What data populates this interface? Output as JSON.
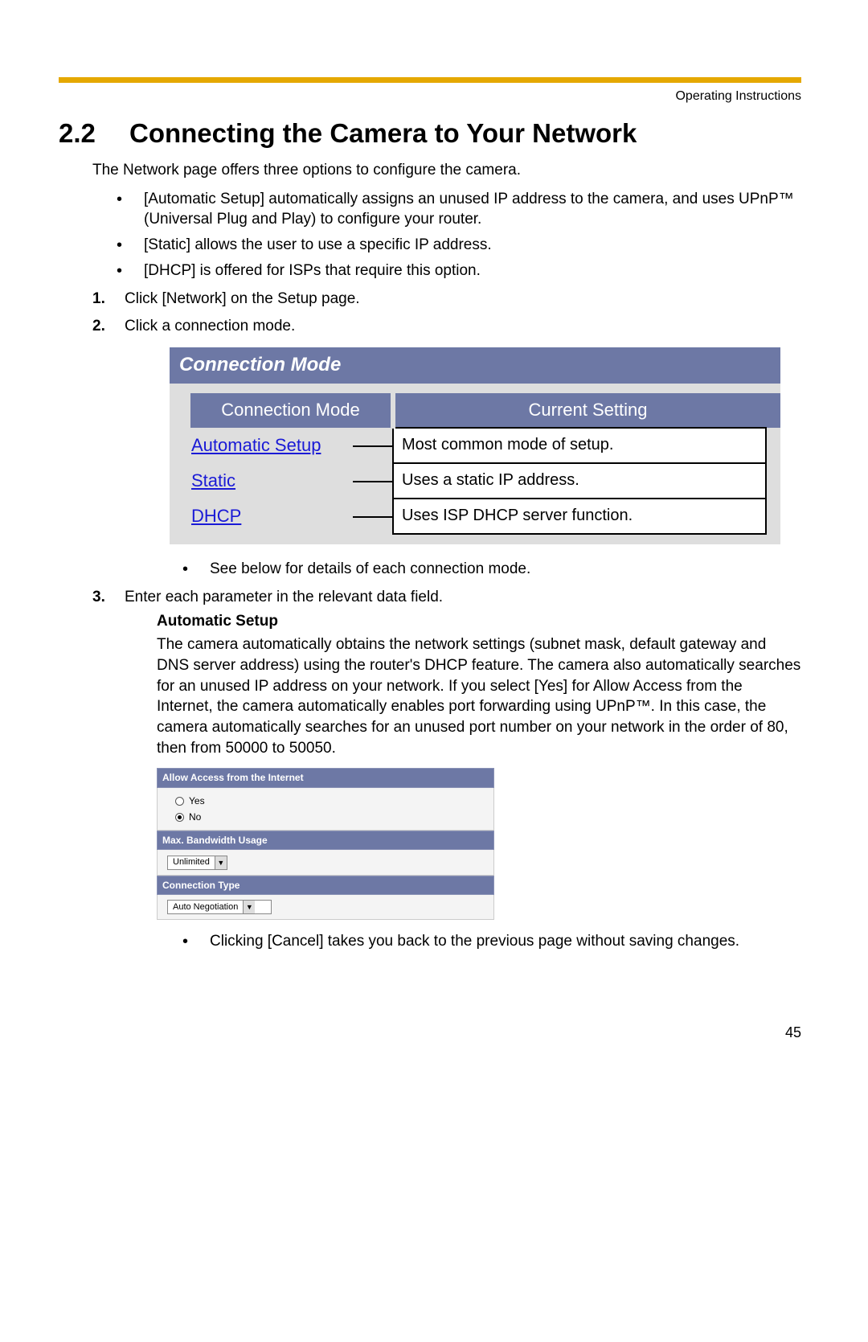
{
  "header": {
    "label": "Operating Instructions"
  },
  "section": {
    "number": "2.2",
    "title": "Connecting the Camera to Your Network"
  },
  "intro": "The Network page offers three options to configure the camera.",
  "options": [
    "[Automatic Setup] automatically assigns an unused IP address to the camera, and uses UPnP™ (Universal Plug and Play) to configure your router.",
    "[Static] allows the user to use a specific IP address.",
    "[DHCP] is offered for ISPs that require this option."
  ],
  "step1": "Click [Network] on the Setup page.",
  "step2": "Click a connection mode.",
  "connFigure": {
    "title": "Connection Mode",
    "col1": "Connection Mode",
    "col2": "Current Setting",
    "rows": [
      {
        "link": "Automatic Setup",
        "desc": "Most common mode of setup."
      },
      {
        "link": "Static",
        "desc": "Uses a static IP address."
      },
      {
        "link": "DHCP",
        "desc": "Uses ISP DHCP server function."
      }
    ]
  },
  "step2_note": "See below for details of each connection mode.",
  "step3": "Enter each parameter in the relevant data field.",
  "auto": {
    "heading": "Automatic Setup",
    "paragraph": "The camera automatically obtains the network settings (subnet mask, default gateway and DNS server address) using the router's DHCP feature. The camera also automatically searches for an unused IP address on your network. If you select [Yes] for Allow Access from the Internet, the camera automatically enables port forwarding using UPnP™. In this case, the camera automatically searches for an unused port number on your network in the order of 80, then from 50000 to 50050."
  },
  "settingsFigure": {
    "allow_header": "Allow Access from the Internet",
    "yes": "Yes",
    "no": "No",
    "bw_header": "Max. Bandwidth Usage",
    "bw_value": "Unlimited",
    "ct_header": "Connection Type",
    "ct_value": "Auto Negotiation"
  },
  "cancel_note": "Clicking [Cancel] takes you back to the previous page without saving changes.",
  "page_number": "45"
}
